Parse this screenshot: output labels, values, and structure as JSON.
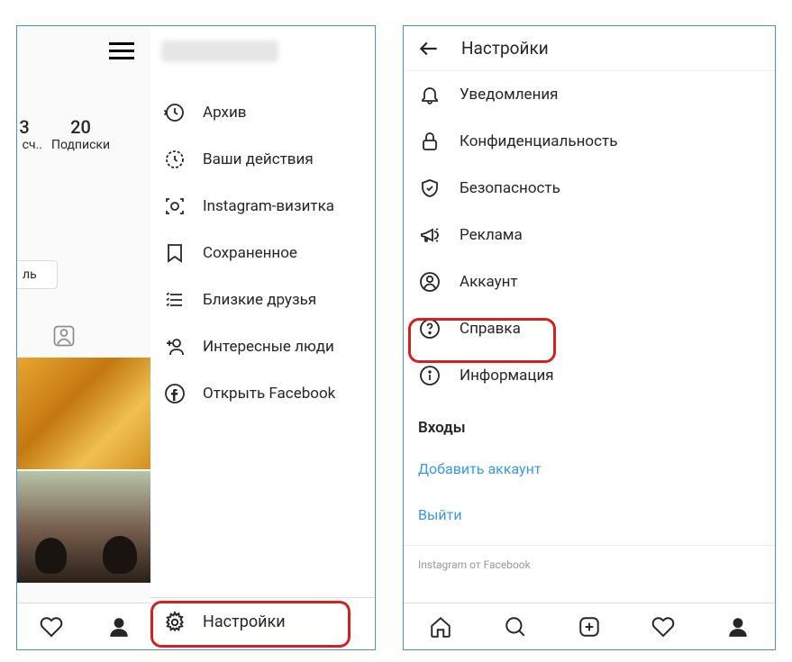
{
  "left": {
    "stats": {
      "following_count": "20",
      "following_label": "Подписки",
      "posts_label_cut": "сч..",
      "posts_count_cut": "3"
    },
    "profile_btn_cut": "ль",
    "menu": {
      "archive": "Архив",
      "activity": "Ваши действия",
      "nametag": "Instagram-визитка",
      "saved": "Сохраненное",
      "close_friends": "Близкие друзья",
      "discover": "Интересные люди",
      "facebook": "Открыть Facebook",
      "settings": "Настройки"
    }
  },
  "right": {
    "title": "Настройки",
    "items": {
      "notifications": "Уведомления",
      "privacy": "Конфиденциальность",
      "security": "Безопасность",
      "ads": "Реклама",
      "account": "Аккаунт",
      "help": "Справка",
      "about": "Информация"
    },
    "section_logins": "Входы",
    "add_account": "Добавить аккаунт",
    "logout": "Выйти",
    "footer": "Instagram от Facebook"
  }
}
